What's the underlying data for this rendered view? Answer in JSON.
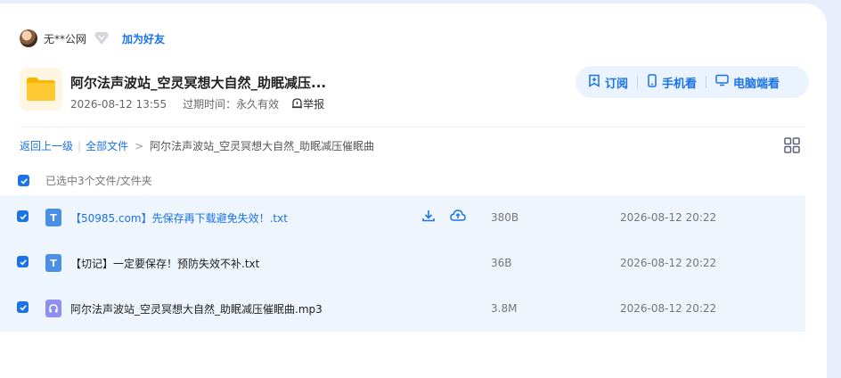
{
  "user": {
    "name": "无**公网",
    "add_friend": "加为好友"
  },
  "share": {
    "title": "阿尔法声波站_空灵冥想大自然_助眠减压...",
    "date": "2026-08-12 13:55",
    "expire": "过期时间：永久有效",
    "report": "举报"
  },
  "actions": {
    "subscribe": "订阅",
    "mobile": "手机看",
    "pc": "电脑端看"
  },
  "breadcrumb": {
    "back": "返回上一级",
    "all": "全部文件",
    "current": "阿尔法声波站_空灵冥想大自然_助眠减压催眠曲"
  },
  "selection": {
    "text": "已选中3个文件/文件夹"
  },
  "files": [
    {
      "icon": "T",
      "name": "【50985.com】先保存再下载避免失效！.txt",
      "size": "380B",
      "date": "2026-08-12 20:22"
    },
    {
      "icon": "T",
      "name": "【切记】一定要保存！预防失效不补.txt",
      "size": "36B",
      "date": "2026-08-12 20:22"
    },
    {
      "icon": "headphones-icon",
      "name": "阿尔法声波站_空灵冥想大自然_助眠减压催眠曲.mp3",
      "size": "3.8M",
      "date": "2026-08-12 20:22"
    }
  ],
  "colors": {
    "accent": "#1a73e8",
    "row_bg": "#eef5fd",
    "page_bg": "#e8eefb"
  }
}
